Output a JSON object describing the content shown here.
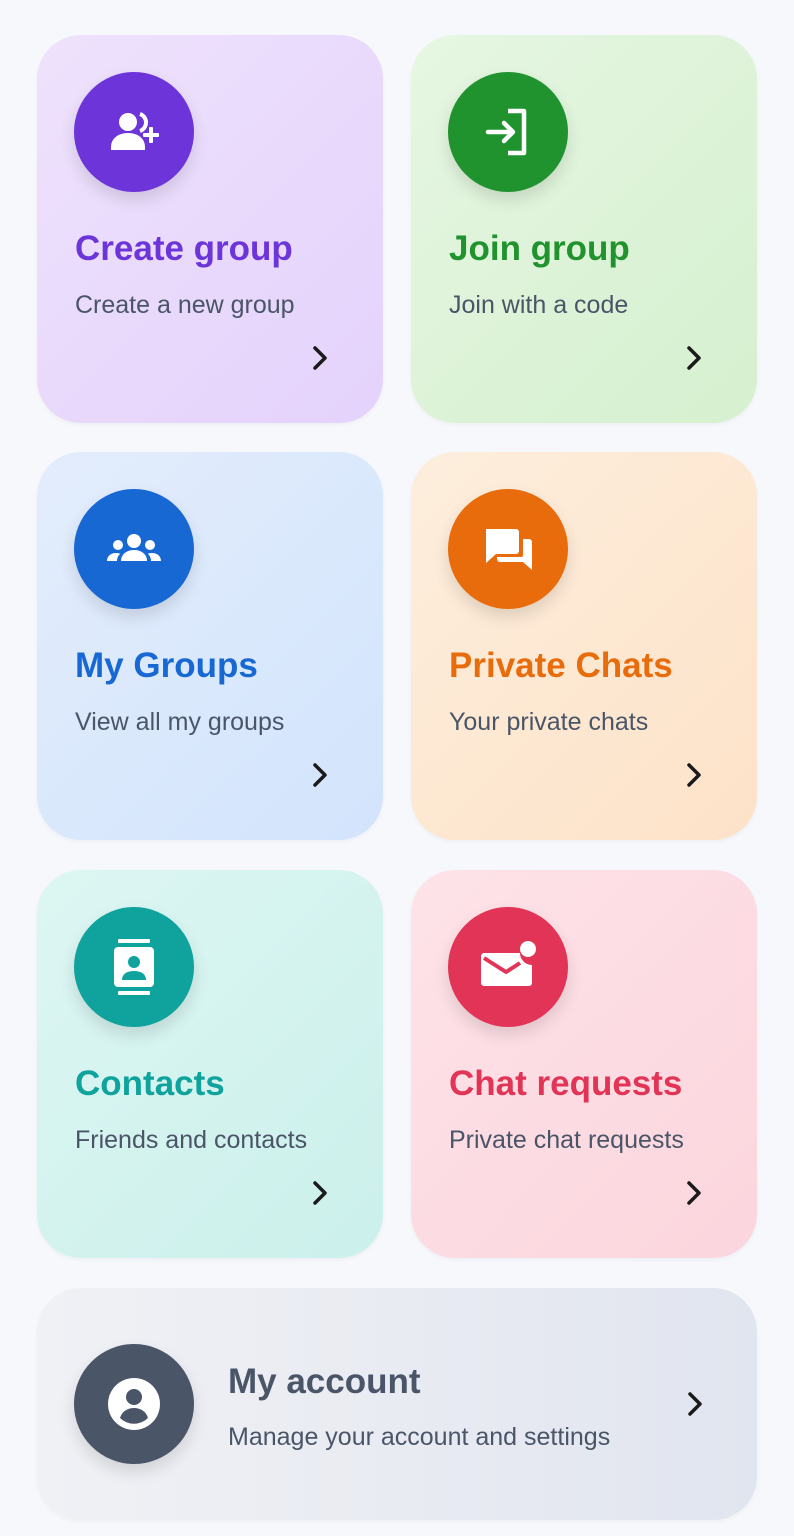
{
  "tiles": {
    "create_group": {
      "title": "Create group",
      "subtitle": "Create a new group",
      "icon": "group-add-icon",
      "accent": "#6d35d9"
    },
    "join_group": {
      "title": "Join group",
      "subtitle": "Join with a code",
      "icon": "login-icon",
      "accent": "#21932e"
    },
    "my_groups": {
      "title": "My Groups",
      "subtitle": "View all my groups",
      "icon": "groups-icon",
      "accent": "#1868d4"
    },
    "private_chats": {
      "title": "Private Chats",
      "subtitle": "Your private chats",
      "icon": "chat-bubbles-icon",
      "accent": "#e86c0c"
    },
    "contacts": {
      "title": "Contacts",
      "subtitle": "Friends and contacts",
      "icon": "contacts-icon",
      "accent": "#10a29c"
    },
    "chat_requests": {
      "title": "Chat requests",
      "subtitle": "Private chat requests",
      "icon": "mail-unread-icon",
      "accent": "#e23456"
    }
  },
  "account": {
    "title": "My account",
    "subtitle": "Manage your account and settings",
    "icon": "account-circle-icon",
    "accent": "#4a5568"
  }
}
